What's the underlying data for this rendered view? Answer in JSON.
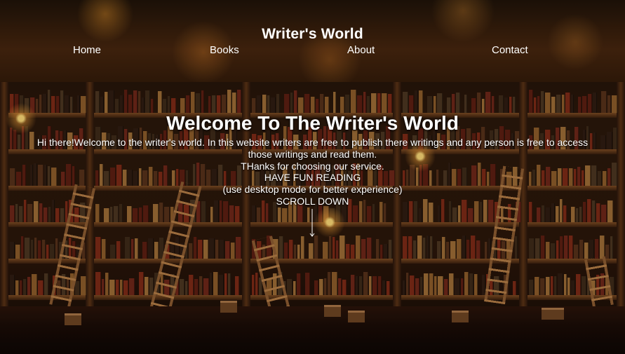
{
  "header": {
    "title": "Writer's World",
    "nav": [
      {
        "label": "Home"
      },
      {
        "label": "Books"
      },
      {
        "label": "About"
      },
      {
        "label": "Contact"
      }
    ]
  },
  "hero": {
    "heading": "Welcome To The Writer's World",
    "intro_line1": "Hi there!Welcome to the writer's world. In this website writers are free to publish there writings and any person is free to access",
    "intro_line2": "those writings and read them.",
    "thanks": "THanks for choosing our service.",
    "fun": "HAVE FUN READING",
    "desktop_note": "(use desktop mode for better experience)",
    "scroll": "SCROLL DOWN",
    "arrow_icon": "down-arrow-icon"
  },
  "colors": {
    "text": "#ffffff",
    "wood_dark": "#2a160a",
    "wood_light": "#7a4a22"
  }
}
